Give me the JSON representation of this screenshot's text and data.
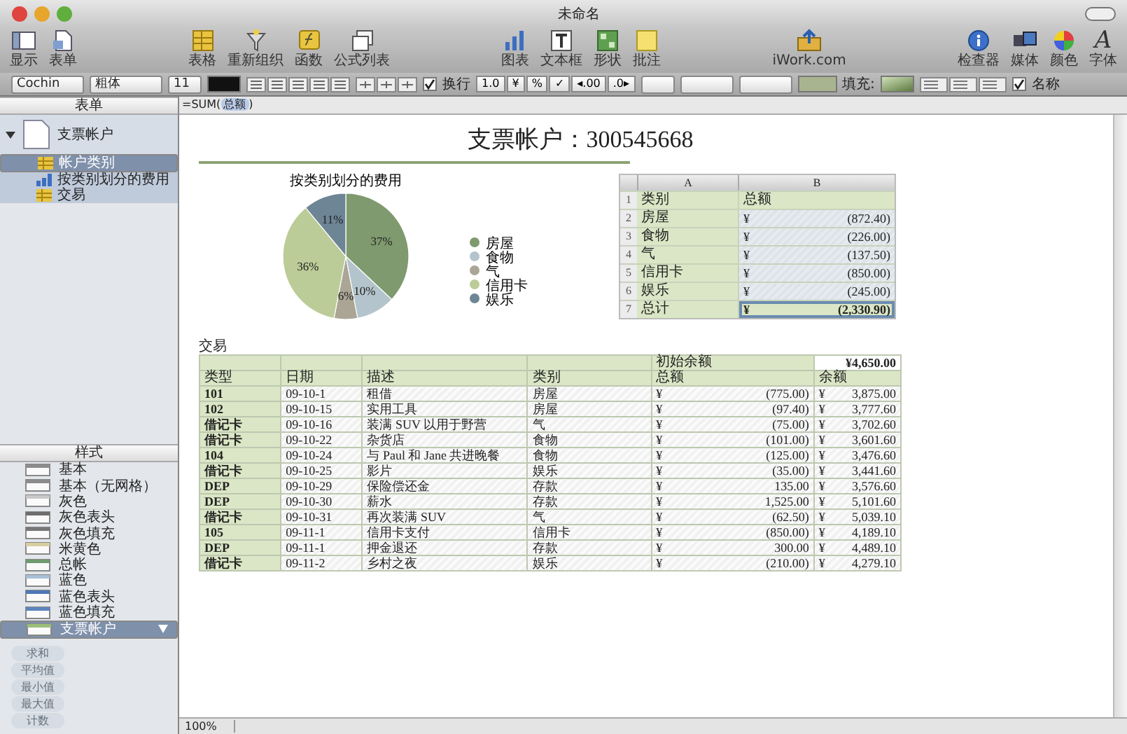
{
  "window": {
    "title": "未命名"
  },
  "toolbar": {
    "groups": [
      [
        {
          "label": "显示"
        },
        {
          "label": "表单"
        }
      ],
      [
        {
          "label": "表格"
        },
        {
          "label": "重新组织"
        },
        {
          "label": "函数"
        },
        {
          "label": "公式列表"
        }
      ],
      [
        {
          "label": "图表"
        },
        {
          "label": "文本框"
        },
        {
          "label": "形状"
        },
        {
          "label": "批注"
        }
      ],
      [
        {
          "label": "iWork.com"
        }
      ],
      [
        {
          "label": "检查器"
        },
        {
          "label": "媒体"
        },
        {
          "label": "颜色"
        },
        {
          "label": "字体",
          "glyph": "A"
        }
      ]
    ]
  },
  "format_bar": {
    "font": "Cochin",
    "style": "粗体",
    "size": "11",
    "wrap": {
      "label": "换行",
      "checked": true
    },
    "number_buttons": [
      "1.0",
      "¥",
      "%",
      "✓",
      "◂.00",
      ".0▸"
    ],
    "fill_label": "填充:",
    "name_option": {
      "label": "名称",
      "checked": true
    }
  },
  "formula_bar": {
    "prefix": "=SUM(",
    "token": "总额",
    "suffix": ")"
  },
  "sidebar": {
    "header": "表单",
    "tree": [
      {
        "label": "支票帐户",
        "expanded": true,
        "children": [
          {
            "label": "帐户类别",
            "kind": "table",
            "selected": true
          },
          {
            "label": "按类别划分的费用",
            "kind": "chart",
            "selected": false
          },
          {
            "label": "交易",
            "kind": "table",
            "selected": false
          }
        ]
      }
    ],
    "styles_header": "样式",
    "styles": [
      {
        "label": "基本",
        "color": "#8c8c8c",
        "selected": false
      },
      {
        "label": "基本（无网格）",
        "color": "#8c8c8c",
        "selected": false
      },
      {
        "label": "灰色",
        "color": "#c8c8c8",
        "selected": false
      },
      {
        "label": "灰色表头",
        "color": "#6e6e6e",
        "selected": false
      },
      {
        "label": "灰色填充",
        "color": "#777777",
        "selected": false
      },
      {
        "label": "米黄色",
        "color": "#d8cfa0",
        "selected": false
      },
      {
        "label": "总帐",
        "color": "#6f9a6f",
        "selected": false
      },
      {
        "label": "蓝色",
        "color": "#a9bfd9",
        "selected": false
      },
      {
        "label": "蓝色表头",
        "color": "#4f78b5",
        "selected": false
      },
      {
        "label": "蓝色填充",
        "color": "#5d84bd",
        "selected": false
      },
      {
        "label": "支票帐户",
        "color": "#9cbf7a",
        "selected": true
      }
    ],
    "quick_formulas": [
      {
        "label": "求和",
        "disabled": true
      },
      {
        "label": "平均值",
        "disabled": true
      },
      {
        "label": "最小值",
        "disabled": true
      },
      {
        "label": "最大值",
        "disabled": true
      },
      {
        "label": "计数",
        "disabled": true
      }
    ]
  },
  "document": {
    "title": "支票帐户：300545668",
    "chart": {
      "chart_data": {
        "type": "pie",
        "title": "按类别划分的费用",
        "categories": [
          "房屋",
          "食物",
          "气",
          "信用卡",
          "娱乐"
        ],
        "values": [
          37,
          10,
          6,
          36,
          11
        ],
        "colors": [
          "#7f9a6e",
          "#b4c4cc",
          "#aaa595",
          "#bccc98",
          "#6d8595"
        ],
        "value_labels": [
          "37%",
          "10%",
          "6%",
          "36%",
          "11%"
        ],
        "legend": true
      }
    },
    "summary_table": {
      "columns": [
        "A",
        "B"
      ],
      "header": {
        "number": "1",
        "category_heading": "类别",
        "total_heading": "总额"
      },
      "rows": [
        {
          "number": "2",
          "kind": "data",
          "category": "房屋",
          "symbol": "¥",
          "total": "(872.40)",
          "selected": false
        },
        {
          "number": "3",
          "kind": "data",
          "category": "食物",
          "symbol": "¥",
          "total": "(226.00)",
          "selected": false
        },
        {
          "number": "4",
          "kind": "data",
          "category": "气",
          "symbol": "¥",
          "total": "(137.50)",
          "selected": false
        },
        {
          "number": "5",
          "kind": "data",
          "category": "信用卡",
          "symbol": "¥",
          "total": "(850.00)",
          "selected": false
        },
        {
          "number": "6",
          "kind": "data",
          "category": "娱乐",
          "symbol": "¥",
          "total": "(245.00)",
          "selected": false
        },
        {
          "number": "7",
          "kind": "total",
          "category": "总计",
          "symbol": "¥",
          "total": "(2,330.90)",
          "selected": true
        }
      ]
    },
    "transactions": {
      "title": "交易",
      "opening_label": "初始余额",
      "opening_balance": "¥4,650.00",
      "columns": [
        "类型",
        "日期",
        "描述",
        "类别",
        "总额",
        "余额"
      ],
      "rows": [
        {
          "type": "101",
          "date": "09-10-1",
          "description": "租借",
          "category": "房屋",
          "amount_symbol": "¥",
          "amount": "(775.00)",
          "balance_symbol": "¥",
          "balance": "3,875.00"
        },
        {
          "type": "102",
          "date": "09-10-15",
          "description": "实用工具",
          "category": "房屋",
          "amount_symbol": "¥",
          "amount": "(97.40)",
          "balance_symbol": "¥",
          "balance": "3,777.60"
        },
        {
          "type": "借记卡",
          "date": "09-10-16",
          "description": "装满 SUV 以用于野营",
          "category": "气",
          "amount_symbol": "¥",
          "amount": "(75.00)",
          "balance_symbol": "¥",
          "balance": "3,702.60"
        },
        {
          "type": "借记卡",
          "date": "09-10-22",
          "description": "杂货店",
          "category": "食物",
          "amount_symbol": "¥",
          "amount": "(101.00)",
          "balance_symbol": "¥",
          "balance": "3,601.60"
        },
        {
          "type": "104",
          "date": "09-10-24",
          "description": "与 Paul 和 Jane 共进晚餐",
          "category": "食物",
          "amount_symbol": "¥",
          "amount": "(125.00)",
          "balance_symbol": "¥",
          "balance": "3,476.60"
        },
        {
          "type": "借记卡",
          "date": "09-10-25",
          "description": "影片",
          "category": "娱乐",
          "amount_symbol": "¥",
          "amount": "(35.00)",
          "balance_symbol": "¥",
          "balance": "3,441.60"
        },
        {
          "type": "DEP",
          "date": "09-10-29",
          "description": "保险偿还金",
          "category": "存款",
          "amount_symbol": "¥",
          "amount": "135.00",
          "balance_symbol": "¥",
          "balance": "3,576.60"
        },
        {
          "type": "DEP",
          "date": "09-10-30",
          "description": "薪水",
          "category": "存款",
          "amount_symbol": "¥",
          "amount": "1,525.00",
          "balance_symbol": "¥",
          "balance": "5,101.60"
        },
        {
          "type": "借记卡",
          "date": "09-10-31",
          "description": "再次装满 SUV",
          "category": "气",
          "amount_symbol": "¥",
          "amount": "(62.50)",
          "balance_symbol": "¥",
          "balance": "5,039.10"
        },
        {
          "type": "105",
          "date": "09-11-1",
          "description": "信用卡支付",
          "category": "信用卡",
          "amount_symbol": "¥",
          "amount": "(850.00)",
          "balance_symbol": "¥",
          "balance": "4,189.10"
        },
        {
          "type": "DEP",
          "date": "09-11-1",
          "description": "押金退还",
          "category": "存款",
          "amount_symbol": "¥",
          "amount": "300.00",
          "balance_symbol": "¥",
          "balance": "4,489.10"
        },
        {
          "type": "借记卡",
          "date": "09-11-2",
          "description": "乡村之夜",
          "category": "娱乐",
          "amount_symbol": "¥",
          "amount": "(210.00)",
          "balance_symbol": "¥",
          "balance": "4,279.10"
        }
      ]
    }
  },
  "status_bar": {
    "zoom": "100%"
  }
}
